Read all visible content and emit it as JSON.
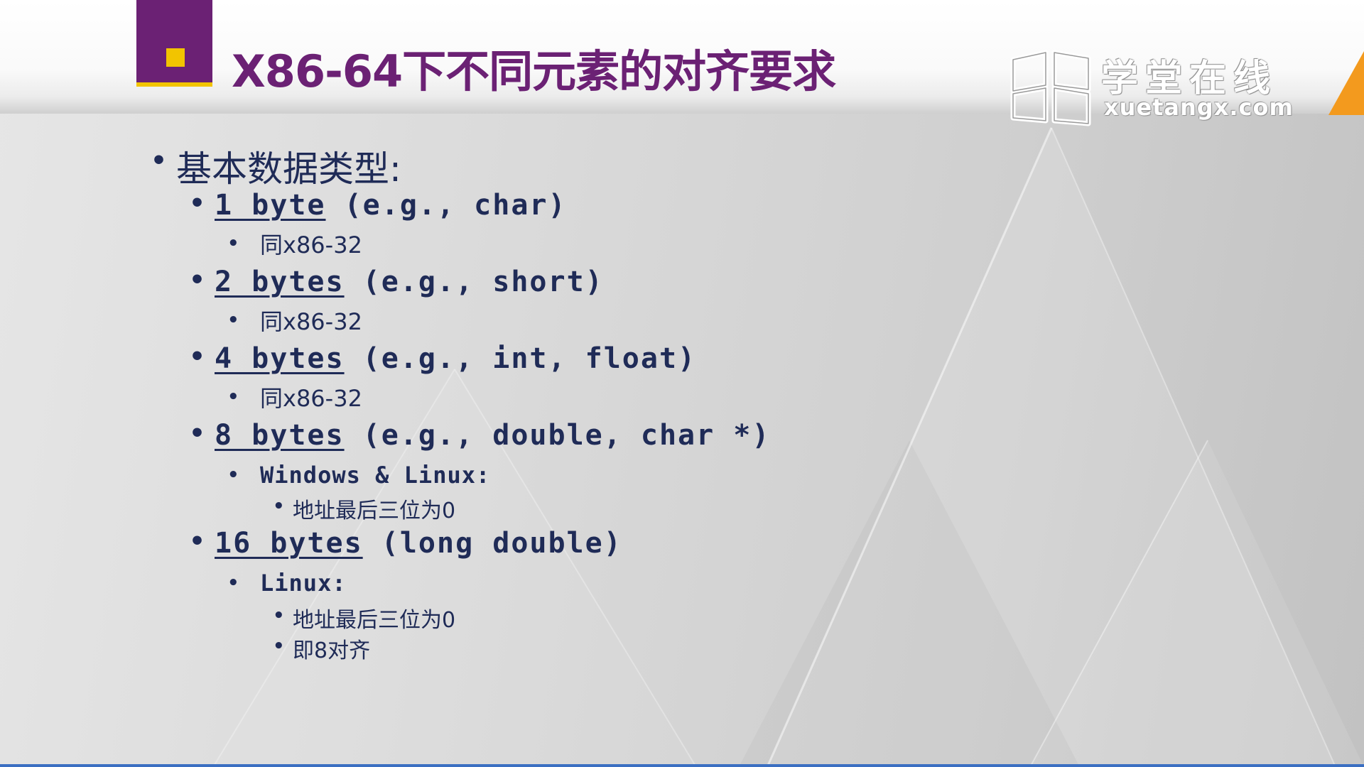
{
  "title": "X86-64下不同元素的对齐要求",
  "logo": {
    "cn": "学堂在线",
    "en": "xuetangx.com"
  },
  "colors": {
    "title": "#6b2174",
    "accent_square": "#6b2174",
    "accent_yellow": "#f2c400",
    "text": "#1f2b57",
    "orange": "#f39a1e",
    "bottom_bar": "#3b6fc2"
  },
  "icons": [
    "book-logo-icon"
  ],
  "content": {
    "heading": "基本数据类型:",
    "items": [
      {
        "size": "1 byte",
        "example": " (e.g., char)",
        "sub": "同x86-32"
      },
      {
        "size": "2 bytes",
        "example": " (e.g., short)",
        "sub": "同x86-32"
      },
      {
        "size": "4 bytes",
        "example": " (e.g., int, float)",
        "sub": "同x86-32"
      },
      {
        "size": "8 bytes",
        "example": " (e.g., double, char *)",
        "sub": "Windows & Linux:",
        "notes": [
          "地址最后三位为0"
        ]
      },
      {
        "size": "16 bytes",
        "example": " (long double)",
        "sub": "Linux:",
        "notes": [
          "地址最后三位为0",
          "即8对齐"
        ]
      }
    ]
  }
}
